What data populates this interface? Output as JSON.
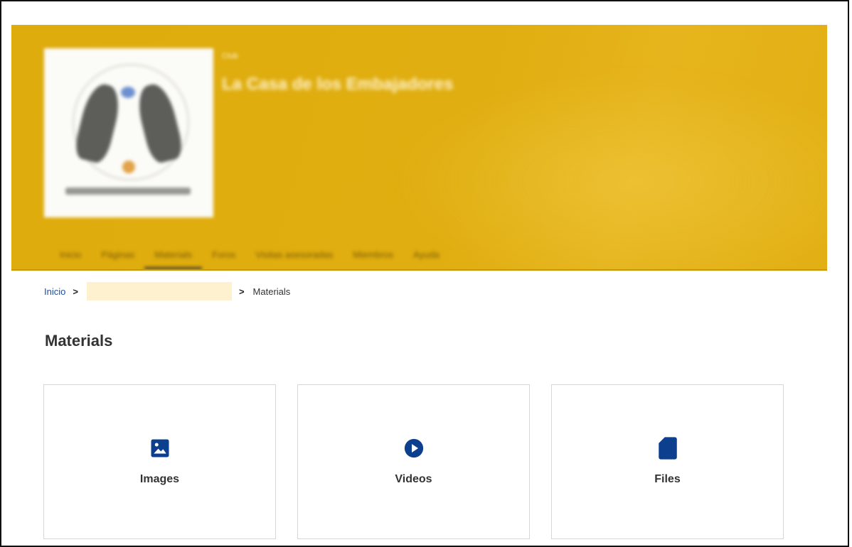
{
  "header": {
    "org_label": "Club",
    "org_title": "La Casa de los Embajadores",
    "logo_icon": "club-logo",
    "nav": [
      {
        "label": "Inicio"
      },
      {
        "label": "Páginas"
      },
      {
        "label": "Materials",
        "active": true
      },
      {
        "label": "Foros"
      },
      {
        "label": "Visitas asesoradas"
      },
      {
        "label": "Miembros"
      },
      {
        "label": "Ayuda"
      }
    ],
    "accent": "#e0ae10"
  },
  "breadcrumb": {
    "home": "Inicio",
    "separator": ">",
    "current": "Materials"
  },
  "page_title": "Materials",
  "cards": [
    {
      "label": "Images",
      "icon": "image-icon"
    },
    {
      "label": "Videos",
      "icon": "play-circle-icon"
    },
    {
      "label": "Files",
      "icon": "file-icon"
    }
  ],
  "colors": {
    "icon": "#0d3f8f",
    "link": "#1e4ea1",
    "masked_crumb": "#fdf1cf"
  }
}
